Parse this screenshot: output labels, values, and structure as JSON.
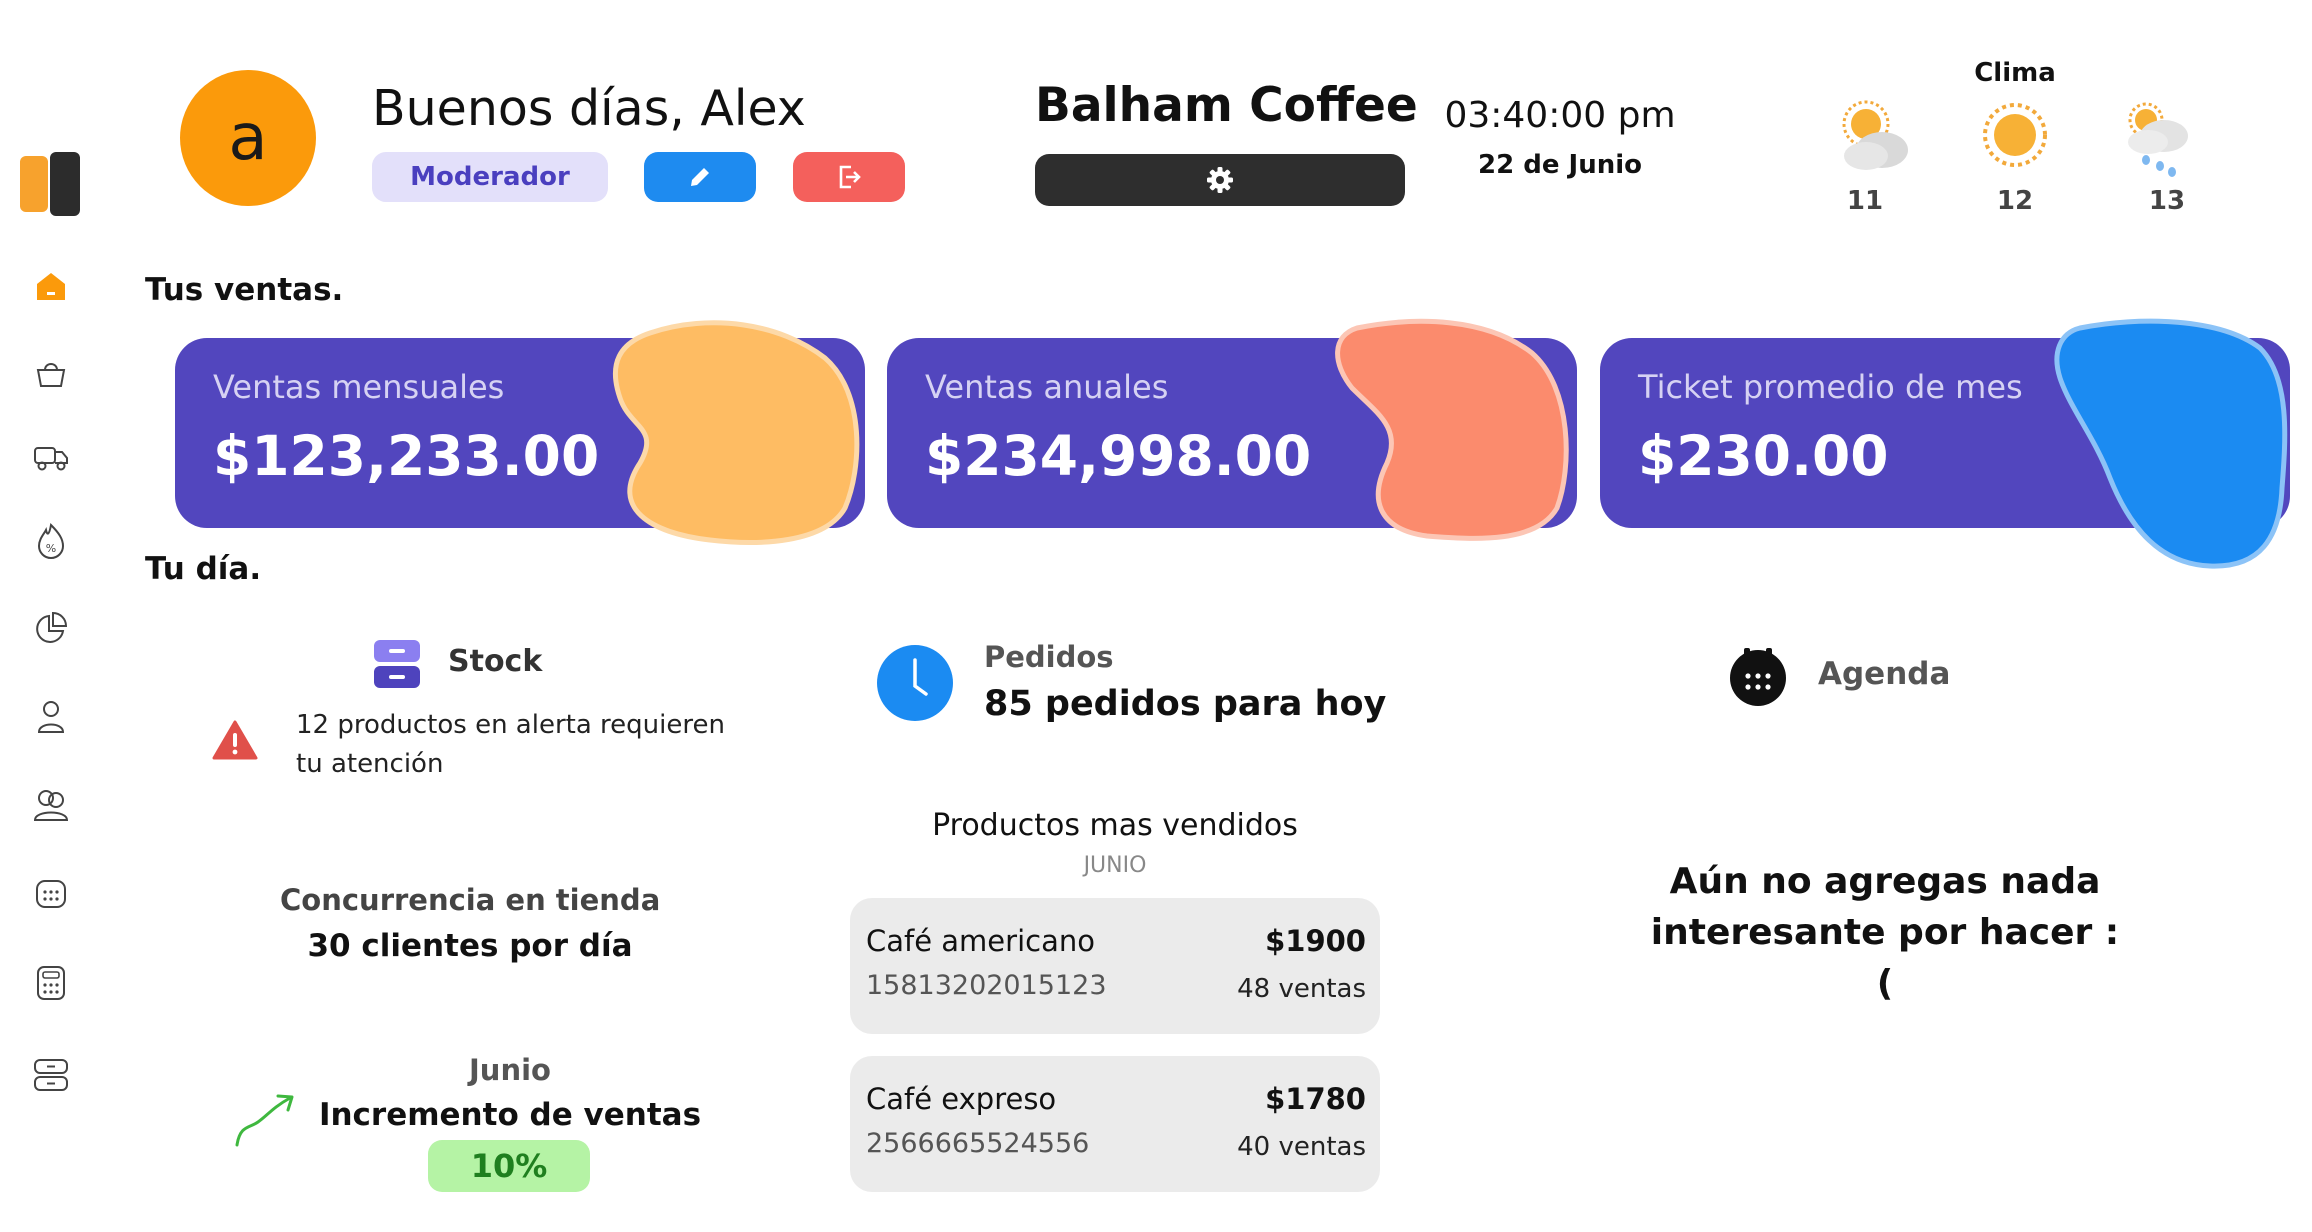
{
  "header": {
    "avatar_letter": "a",
    "greeting": "Buenos días, Alex",
    "role": "Moderador",
    "store_name": "Balham Coffee",
    "time": "03:40:00 pm",
    "date": "22 de Junio"
  },
  "weather": {
    "title": "Clima",
    "days": [
      {
        "day": "11",
        "icon": "partly-cloudy-icon"
      },
      {
        "day": "12",
        "icon": "sun-icon"
      },
      {
        "day": "13",
        "icon": "rain-cloud-icon"
      }
    ]
  },
  "sections": {
    "sales_title": "Tus ventas.",
    "day_title": "Tu día."
  },
  "cards": [
    {
      "label": "Ventas mensuales",
      "value": "$123,233.00",
      "blob_color": "#FEBC63"
    },
    {
      "label": "Ventas anuales",
      "value": "$234,998.00",
      "blob_color": "#FB8B6D"
    },
    {
      "label": "Ticket promedio de mes",
      "value": "$230.00",
      "blob_color": "#1B8BF2"
    }
  ],
  "stock": {
    "title": "Stock",
    "alert": "12 productos en alerta requieren tu atención"
  },
  "pedidos": {
    "title": "Pedidos",
    "value": "85 pedidos para hoy"
  },
  "agenda": {
    "title": "Agenda",
    "empty_message": "Aún no agregas nada interesante por hacer :("
  },
  "concurrencia": {
    "label": "Concurrencia en tienda",
    "value": "30 clientes por día"
  },
  "incremento": {
    "month": "Junio",
    "label": "Incremento de ventas",
    "percent": "10%"
  },
  "top_products": {
    "title": "Productos mas vendidos",
    "subtitle": "JUNIO",
    "items": [
      {
        "name": "Café americano",
        "code": "15813202015123",
        "price": "$1900",
        "sales": "48 ventas"
      },
      {
        "name": "Café expreso",
        "code": "2566665524556",
        "price": "$1780",
        "sales": "40 ventas"
      }
    ]
  },
  "colors": {
    "accent_purple": "#5246BE",
    "avatar_orange": "#FB9A0B",
    "edit_blue": "#1E8BF0",
    "logout_red": "#F4605C",
    "success_green": "#B5F3A5"
  }
}
